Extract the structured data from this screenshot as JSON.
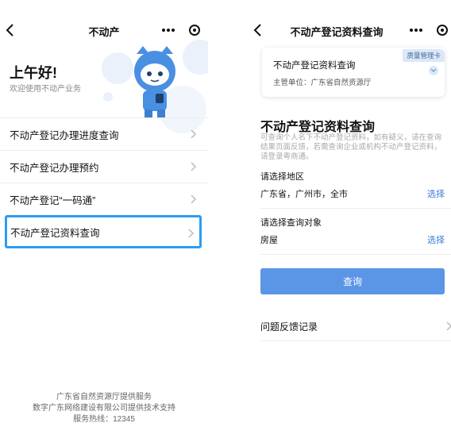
{
  "left": {
    "nav_title": "不动产",
    "greeting": "上午好!",
    "welcome": "欢迎使用不动产业务",
    "menu": [
      {
        "label": "不动产登记办理进度查询"
      },
      {
        "label": "不动产登记办理预约"
      },
      {
        "label": "不动产登记“一码通”"
      },
      {
        "label": "不动产登记资料查询",
        "highlighted": true
      }
    ],
    "footer": {
      "line1": "广东省自然资源厅提供服务",
      "line2": "数字广东网络建设有限公司提供技术支持",
      "line3": "服务热线：12345"
    }
  },
  "right": {
    "nav_title": "不动产登记资料查询",
    "card": {
      "title": "不动产登记资料查询",
      "unit": "主管单位：广东省自然资源厅",
      "badge": "质量管理卡"
    },
    "query_title": "不动产登记资料查询",
    "query_desc": "可查询个人名下不动产登记资料，如有疑义，请在查询结果页面反馈，若需查询企业或机构不动产登记资料，请登录粤商通。",
    "region": {
      "label": "请选择地区",
      "value": "广东省，广州市，全市",
      "action": "选择"
    },
    "target": {
      "label": "请选择查询对象",
      "value": "房屋",
      "action": "选择"
    },
    "query_button": "查询",
    "feedback": "问题反馈记录"
  },
  "colors": {
    "accent": "#5b95e6",
    "link": "#3a7bd5",
    "highlight_border": "#2a9df4",
    "mascot": "#4a90e2"
  },
  "icons": [
    "back-icon",
    "more-icon",
    "target-icon",
    "chevron-right-icon",
    "chevron-down-icon",
    "mascot-illustration"
  ]
}
